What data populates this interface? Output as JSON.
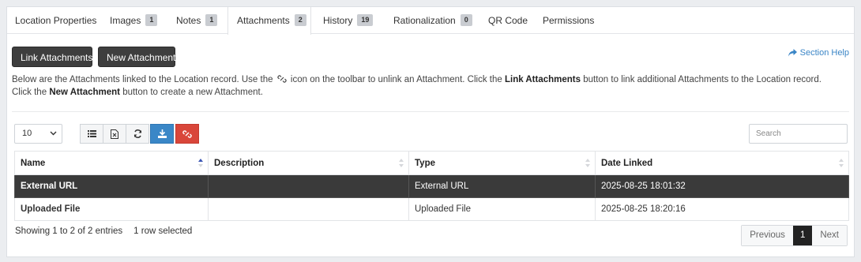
{
  "tabs": [
    {
      "label": "Location Properties",
      "badge": null
    },
    {
      "label": "Images",
      "badge": "1"
    },
    {
      "label": "Notes",
      "badge": "1"
    },
    {
      "label": "Attachments",
      "badge": "2",
      "active": true
    },
    {
      "label": "History",
      "badge": "19"
    },
    {
      "label": "Rationalization",
      "badge": "0"
    },
    {
      "label": "QR Code",
      "badge": null
    },
    {
      "label": "Permissions",
      "badge": null
    }
  ],
  "actions": {
    "link_label": "Link Attachments",
    "new_label": "New Attachment",
    "help_label": "Section Help"
  },
  "description": {
    "part1": "Below are the Attachments linked to the Location record. Use the",
    "part2": "icon on the toolbar to unlink an Attachment. Click the",
    "bold1": "Link Attachments",
    "part3": "button to link additional Attachments to the Location record. Click the",
    "bold2": "New Attachment",
    "part4": "button to create a new Attachment."
  },
  "toolbar": {
    "page_length": "10",
    "buttons": [
      "list-icon",
      "excel-export-icon",
      "refresh-icon",
      "download-icon",
      "unlink-icon"
    ],
    "search_placeholder": "Search"
  },
  "table": {
    "columns": [
      "Name",
      "Description",
      "Type",
      "Date Linked"
    ],
    "rows": [
      {
        "name": "External URL",
        "description": "",
        "type": "External URL",
        "date": "2025-08-25 18:01:32",
        "selected": true
      },
      {
        "name": "Uploaded File",
        "description": "",
        "type": "Uploaded File",
        "date": "2025-08-25 18:20:16",
        "selected": false
      }
    ]
  },
  "footer": {
    "info": "Showing 1 to 2 of 2 entries",
    "selected": "1 row selected",
    "previous": "Previous",
    "page": "1",
    "next": "Next"
  },
  "colors": {
    "selected_row": "#3a3a3a",
    "blue": "#3a87c7",
    "red": "#d9463a",
    "link": "#3a85c6"
  }
}
